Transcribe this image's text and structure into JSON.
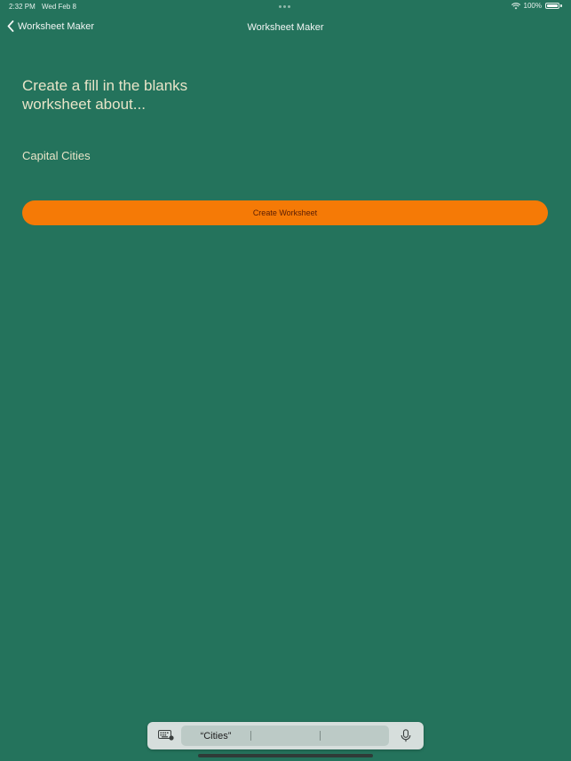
{
  "status_bar": {
    "time": "2:32 PM",
    "date": "Wed Feb 8",
    "battery": "100%"
  },
  "nav": {
    "back_label": "Worksheet Maker",
    "title": "Worksheet Maker"
  },
  "prompt": {
    "heading": "Create a fill in the blanks worksheet about..."
  },
  "topic_input": {
    "value": "Capital Cities"
  },
  "create_button": {
    "label": "Create Worksheet"
  },
  "keyboard_bar": {
    "suggestions": [
      "“Cities”",
      "",
      ""
    ]
  },
  "colors": {
    "background": "#24735c",
    "accent": "#f57a06",
    "heading_text": "#e8e4c8"
  },
  "icons": {
    "back": "chevron-left-icon",
    "wifi": "wifi-icon",
    "battery": "battery-icon",
    "keyboard": "keyboard-icon",
    "mic": "microphone-icon"
  }
}
